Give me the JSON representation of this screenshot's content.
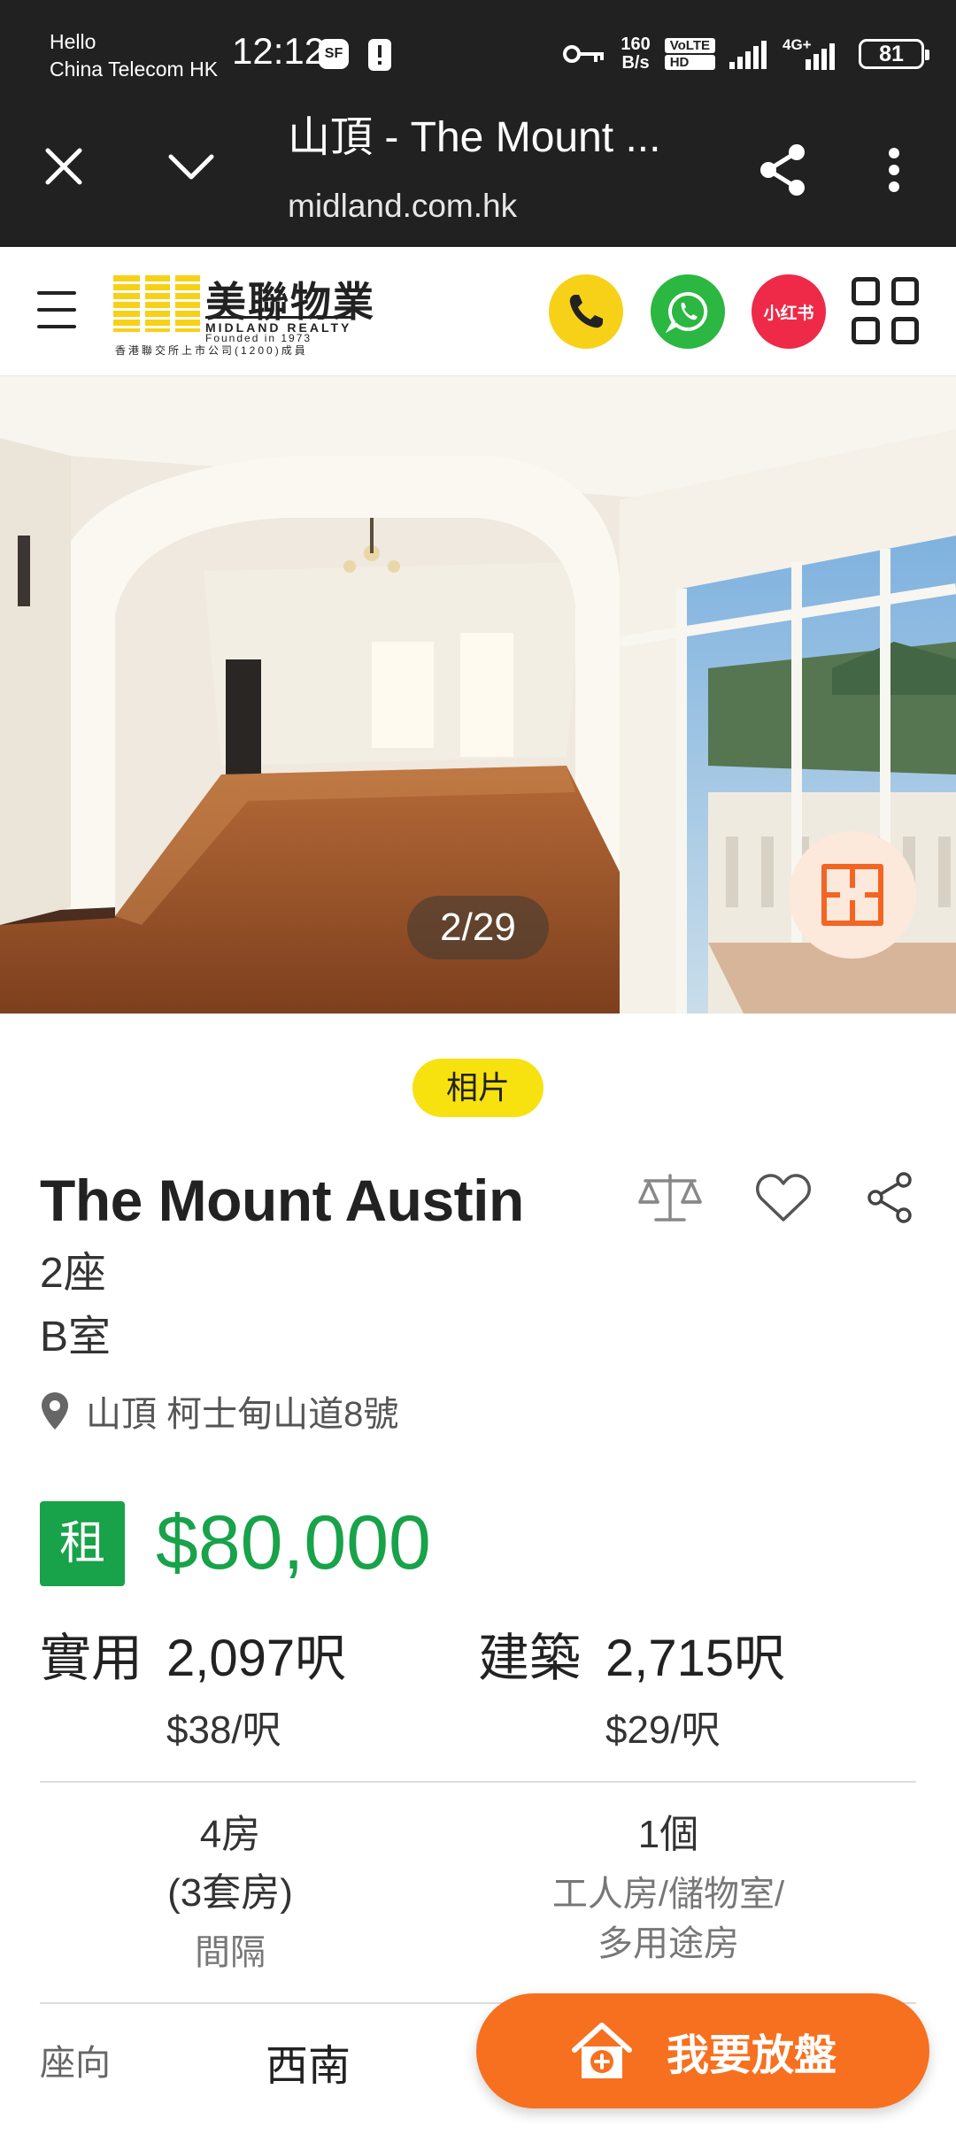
{
  "status_bar": {
    "greeting": "Hello",
    "carrier": "China Telecom HK",
    "time": "12:12",
    "app_badge": "SF",
    "net_speed_value": "160",
    "net_speed_unit": "B/s",
    "volte": "VoLTE",
    "hd": "HD",
    "network": "4G+",
    "battery": "81"
  },
  "browser": {
    "tab_title": "山頂 - The Mount ...",
    "url": "midland.com.hk"
  },
  "site_header": {
    "logo_cn": "美聯物業",
    "logo_en": "MIDLAND REALTY",
    "logo_founded": "Founded in 1973",
    "logo_sub": "香港聯交所上市公司(1200)成員",
    "xhs_label": "小红书"
  },
  "gallery": {
    "counter": "2/29",
    "tab_label": "相片"
  },
  "listing": {
    "title": "The Mount Austin",
    "block": "2座",
    "unit": "B室",
    "address": "山頂 柯士甸山道8號",
    "rent_label": "租",
    "price": "$80,000",
    "saleable_label": "實用",
    "saleable_area": "2,097呎",
    "saleable_unit_price": "$38/呎",
    "gross_label": "建築",
    "gross_area": "2,715呎",
    "gross_unit_price": "$29/呎",
    "rooms": "4房",
    "suites": "(3套房)",
    "layout_label": "間隔",
    "extra_count": "1個",
    "extra_type_1": "工人房/儲物室/",
    "extra_type_2": "多用途房",
    "facing_label": "座向",
    "facing_value": "西南"
  },
  "cta": {
    "label": "我要放盤"
  },
  "colors": {
    "green": "#18a24a",
    "orange": "#f7701f",
    "yellow": "#f7d117",
    "whatsapp": "#2bb741",
    "xhs": "#ee2a48"
  }
}
